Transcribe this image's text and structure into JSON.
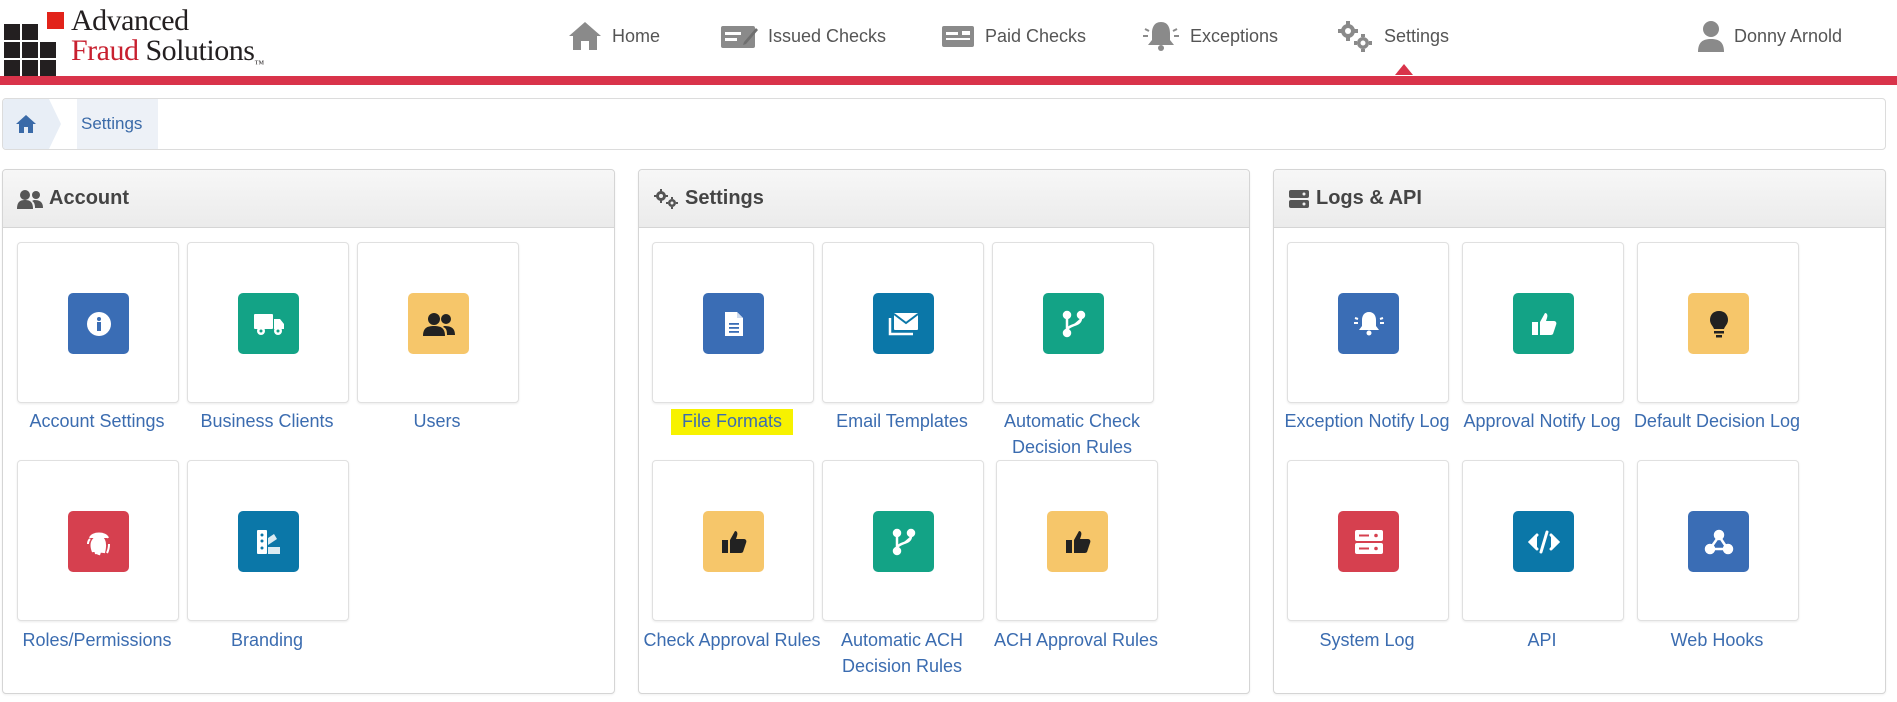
{
  "logo": {
    "line1": "Advanced",
    "line2a": "Fraud",
    "line2b": " Solutions",
    "tm": "™"
  },
  "nav": {
    "home": "Home",
    "issued_checks": "Issued Checks",
    "paid_checks": "Paid Checks",
    "exceptions": "Exceptions",
    "settings": "Settings",
    "user": "Donny Arnold",
    "active": "settings"
  },
  "breadcrumb": {
    "current": "Settings"
  },
  "panels": {
    "account": {
      "title": "Account",
      "tiles": [
        {
          "label": "Account Settings",
          "icon": "info-icon",
          "color": "#3a6db5"
        },
        {
          "label": "Business Clients",
          "icon": "truck-icon",
          "color": "#13a386"
        },
        {
          "label": "Users",
          "icon": "users-icon",
          "color": "#f6c66a"
        },
        {
          "label": "Roles/Permissions",
          "icon": "fingerprint-icon",
          "color": "#d6404f"
        },
        {
          "label": "Branding",
          "icon": "swatchbook-icon",
          "color": "#0b77a8"
        }
      ]
    },
    "settings": {
      "title": "Settings",
      "tiles": [
        {
          "label": "File Formats",
          "icon": "file-icon",
          "color": "#3a6db5",
          "highlighted": true
        },
        {
          "label": "Email Templates",
          "icon": "envelopes-icon",
          "color": "#0b77a8"
        },
        {
          "label": "Automatic Check Decision Rules",
          "icon": "code-branch-icon",
          "color": "#13a386"
        },
        {
          "label": "Check Approval Rules",
          "icon": "thumbs-up-icon",
          "color": "#f6c66a"
        },
        {
          "label": "Automatic ACH Decision Rules",
          "icon": "code-branch-icon",
          "color": "#13a386"
        },
        {
          "label": "ACH Approval Rules",
          "icon": "thumbs-up-icon",
          "color": "#f6c66a"
        }
      ]
    },
    "logs": {
      "title": "Logs & API",
      "tiles": [
        {
          "label": "Exception Notify Log",
          "icon": "bell-icon",
          "color": "#3a6db5"
        },
        {
          "label": "Approval Notify Log",
          "icon": "thumbs-up-icon",
          "color": "#13a386"
        },
        {
          "label": "Default Decision Log",
          "icon": "lightbulb-icon",
          "color": "#f6c66a"
        },
        {
          "label": "System Log",
          "icon": "server-icon",
          "color": "#d6404f"
        },
        {
          "label": "API",
          "icon": "code-icon",
          "color": "#0b77a8"
        },
        {
          "label": "Web Hooks",
          "icon": "webhook-icon",
          "color": "#3a6db5"
        }
      ]
    }
  }
}
